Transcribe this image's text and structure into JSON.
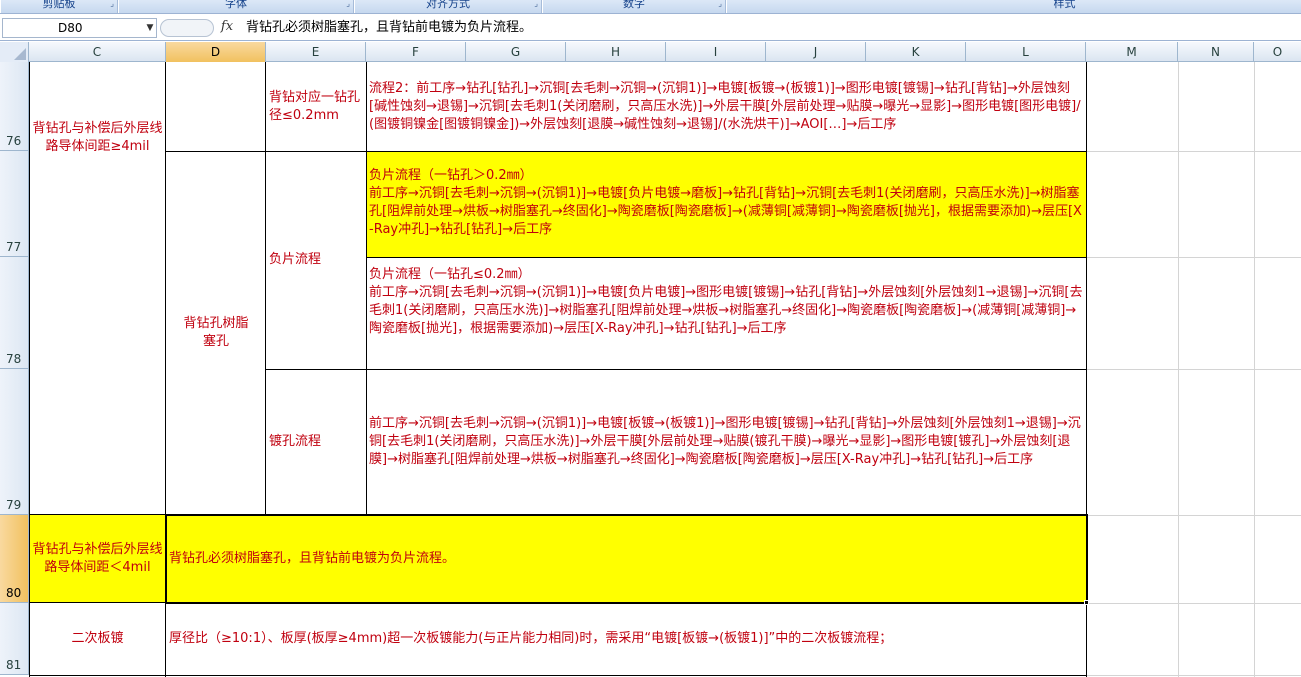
{
  "ribbon": {
    "groups": [
      "剪贴板",
      "字体",
      "对齐方式",
      "数字",
      "样式"
    ]
  },
  "formula_bar": {
    "name_box": "D80",
    "fx_label": "fx",
    "content": "背钻孔必须树脂塞孔，且背钻前电镀为负片流程。"
  },
  "columns": [
    "C",
    "D",
    "E",
    "F",
    "G",
    "H",
    "I",
    "J",
    "K",
    "L",
    "M",
    "N",
    "O"
  ],
  "rows": [
    "76",
    "77",
    "78",
    "79",
    "80",
    "81"
  ],
  "selected_column": "D",
  "selected_row": "80",
  "cells": {
    "c76": "背钻孔与补偿后外层线路导体间距≥4mil",
    "d77": "背钻孔树脂塞孔",
    "e76": "背钻对应一钻孔径≤0.2mm",
    "f76": "流程2：前工序→钻孔[钻孔]→沉铜[去毛刺→沉铜→(沉铜1)]→电镀[板镀→(板镀1)]→图形电镀[镀锡]→钻孔[背钻]→外层蚀刻[碱性蚀刻→退锡]→沉铜[去毛刺1(关闭磨刷，只高压水洗)]→外层干膜[外层前处理→贴膜→曝光→显影]→图形电镀[图形电镀]/(图镀铜镍金[图镀铜镍金])→外层蚀刻[退膜→碱性蚀刻→退锡]/(水洗烘干)]→AOI[…]→后工序",
    "e77": "负片流程",
    "f77_title": "负片流程（一钻孔＞0.2㎜）",
    "f77": "前工序→沉铜[去毛刺→沉铜→(沉铜1)]→电镀[负片电镀→磨板]→钻孔[背钻]→沉铜[去毛刺1(关闭磨刷，只高压水洗)]→树脂塞孔[阻焊前处理→烘板→树脂塞孔→终固化]→陶瓷磨板[陶瓷磨板]→(减薄铜[减薄铜]→陶瓷磨板[抛光]，根据需要添加)→层压[X-Ray冲孔]→钻孔[钻孔]→后工序",
    "f78_title": "负片流程（一钻孔≤0.2㎜）",
    "f78": "前工序→沉铜[去毛刺→沉铜→(沉铜1)]→电镀[负片电镀]→图形电镀[镀锡]→钻孔[背钻]→外层蚀刻[外层蚀刻1→退锡]→沉铜[去毛刺1(关闭磨刷，只高压水洗)]→树脂塞孔[阻焊前处理→烘板→树脂塞孔→终固化]→陶瓷磨板[陶瓷磨板]→(减薄铜[减薄铜]→陶瓷磨板[抛光]，根据需要添加)→层压[X-Ray冲孔]→钻孔[钻孔]→后工序",
    "e79": "镀孔流程",
    "f79": "前工序→沉铜[去毛刺→沉铜→(沉铜1)]→电镀[板镀→(板镀1)]→图形电镀[镀锡]→钻孔[背钻]→外层蚀刻[外层蚀刻1→退锡]→沉铜[去毛刺1(关闭磨刷，只高压水洗)]→外层干膜[外层前处理→贴膜(镀孔干膜)→曝光→显影]→图形电镀[镀孔]→外层蚀刻[退膜]→树脂塞孔[阻焊前处理→烘板→树脂塞孔→终固化]→陶瓷磨板[陶瓷磨板]→层压[X-Ray冲孔]→钻孔[钻孔]→后工序",
    "c80": "背钻孔与补偿后外层线路导体间距＜4mil",
    "d80": "背钻孔必须树脂塞孔，且背钻前电镀为负片流程。",
    "c81": "二次板镀",
    "d81": "厚径比（≥10:1）、板厚(板厚≥4mm)超一次板镀能力(与正片能力相同)时，需采用“电镀[板镀→(板镀1)]”中的二次板镀流程；"
  },
  "colors": {
    "text_red": "#c0000f",
    "highlight_yellow": "#ffff00",
    "header_selected": "#f1c15f"
  }
}
